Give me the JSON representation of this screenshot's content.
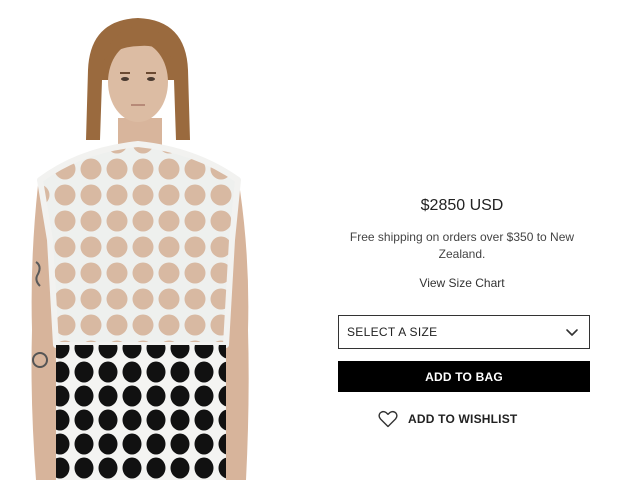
{
  "product": {
    "price": "$2850 USD",
    "shipping_note": "Free shipping on orders over $350 to New Zealand.",
    "size_chart_link": "View Size Chart",
    "size_select": {
      "selected": "SELECT A SIZE"
    },
    "add_to_bag_label": "ADD TO BAG",
    "wishlist_label": "ADD TO WISHLIST"
  },
  "icons": {
    "size_select": "chevron-down-icon",
    "wishlist": "heart-outline-icon"
  },
  "colors": {
    "button_bg": "#000000",
    "button_text": "#ffffff",
    "text": "#222222",
    "border": "#333333"
  }
}
